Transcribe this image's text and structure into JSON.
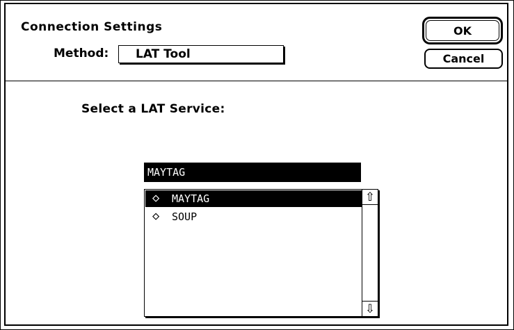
{
  "dialog": {
    "title": "Connection Settings",
    "method_label": "Method:",
    "method_value": "LAT Tool",
    "ok_label": "OK",
    "cancel_label": "Cancel",
    "prompt": "Select a LAT Service:",
    "service_field_value": "MAYTAG"
  },
  "services": [
    {
      "icon": "diamond-icon",
      "glyph": "◇",
      "label": "MAYTAG",
      "selected": true
    },
    {
      "icon": "diamond-icon",
      "glyph": "◇",
      "label": "SOUP",
      "selected": false
    }
  ],
  "scroll": {
    "up_glyph": "⇧",
    "down_glyph": "⇩"
  }
}
